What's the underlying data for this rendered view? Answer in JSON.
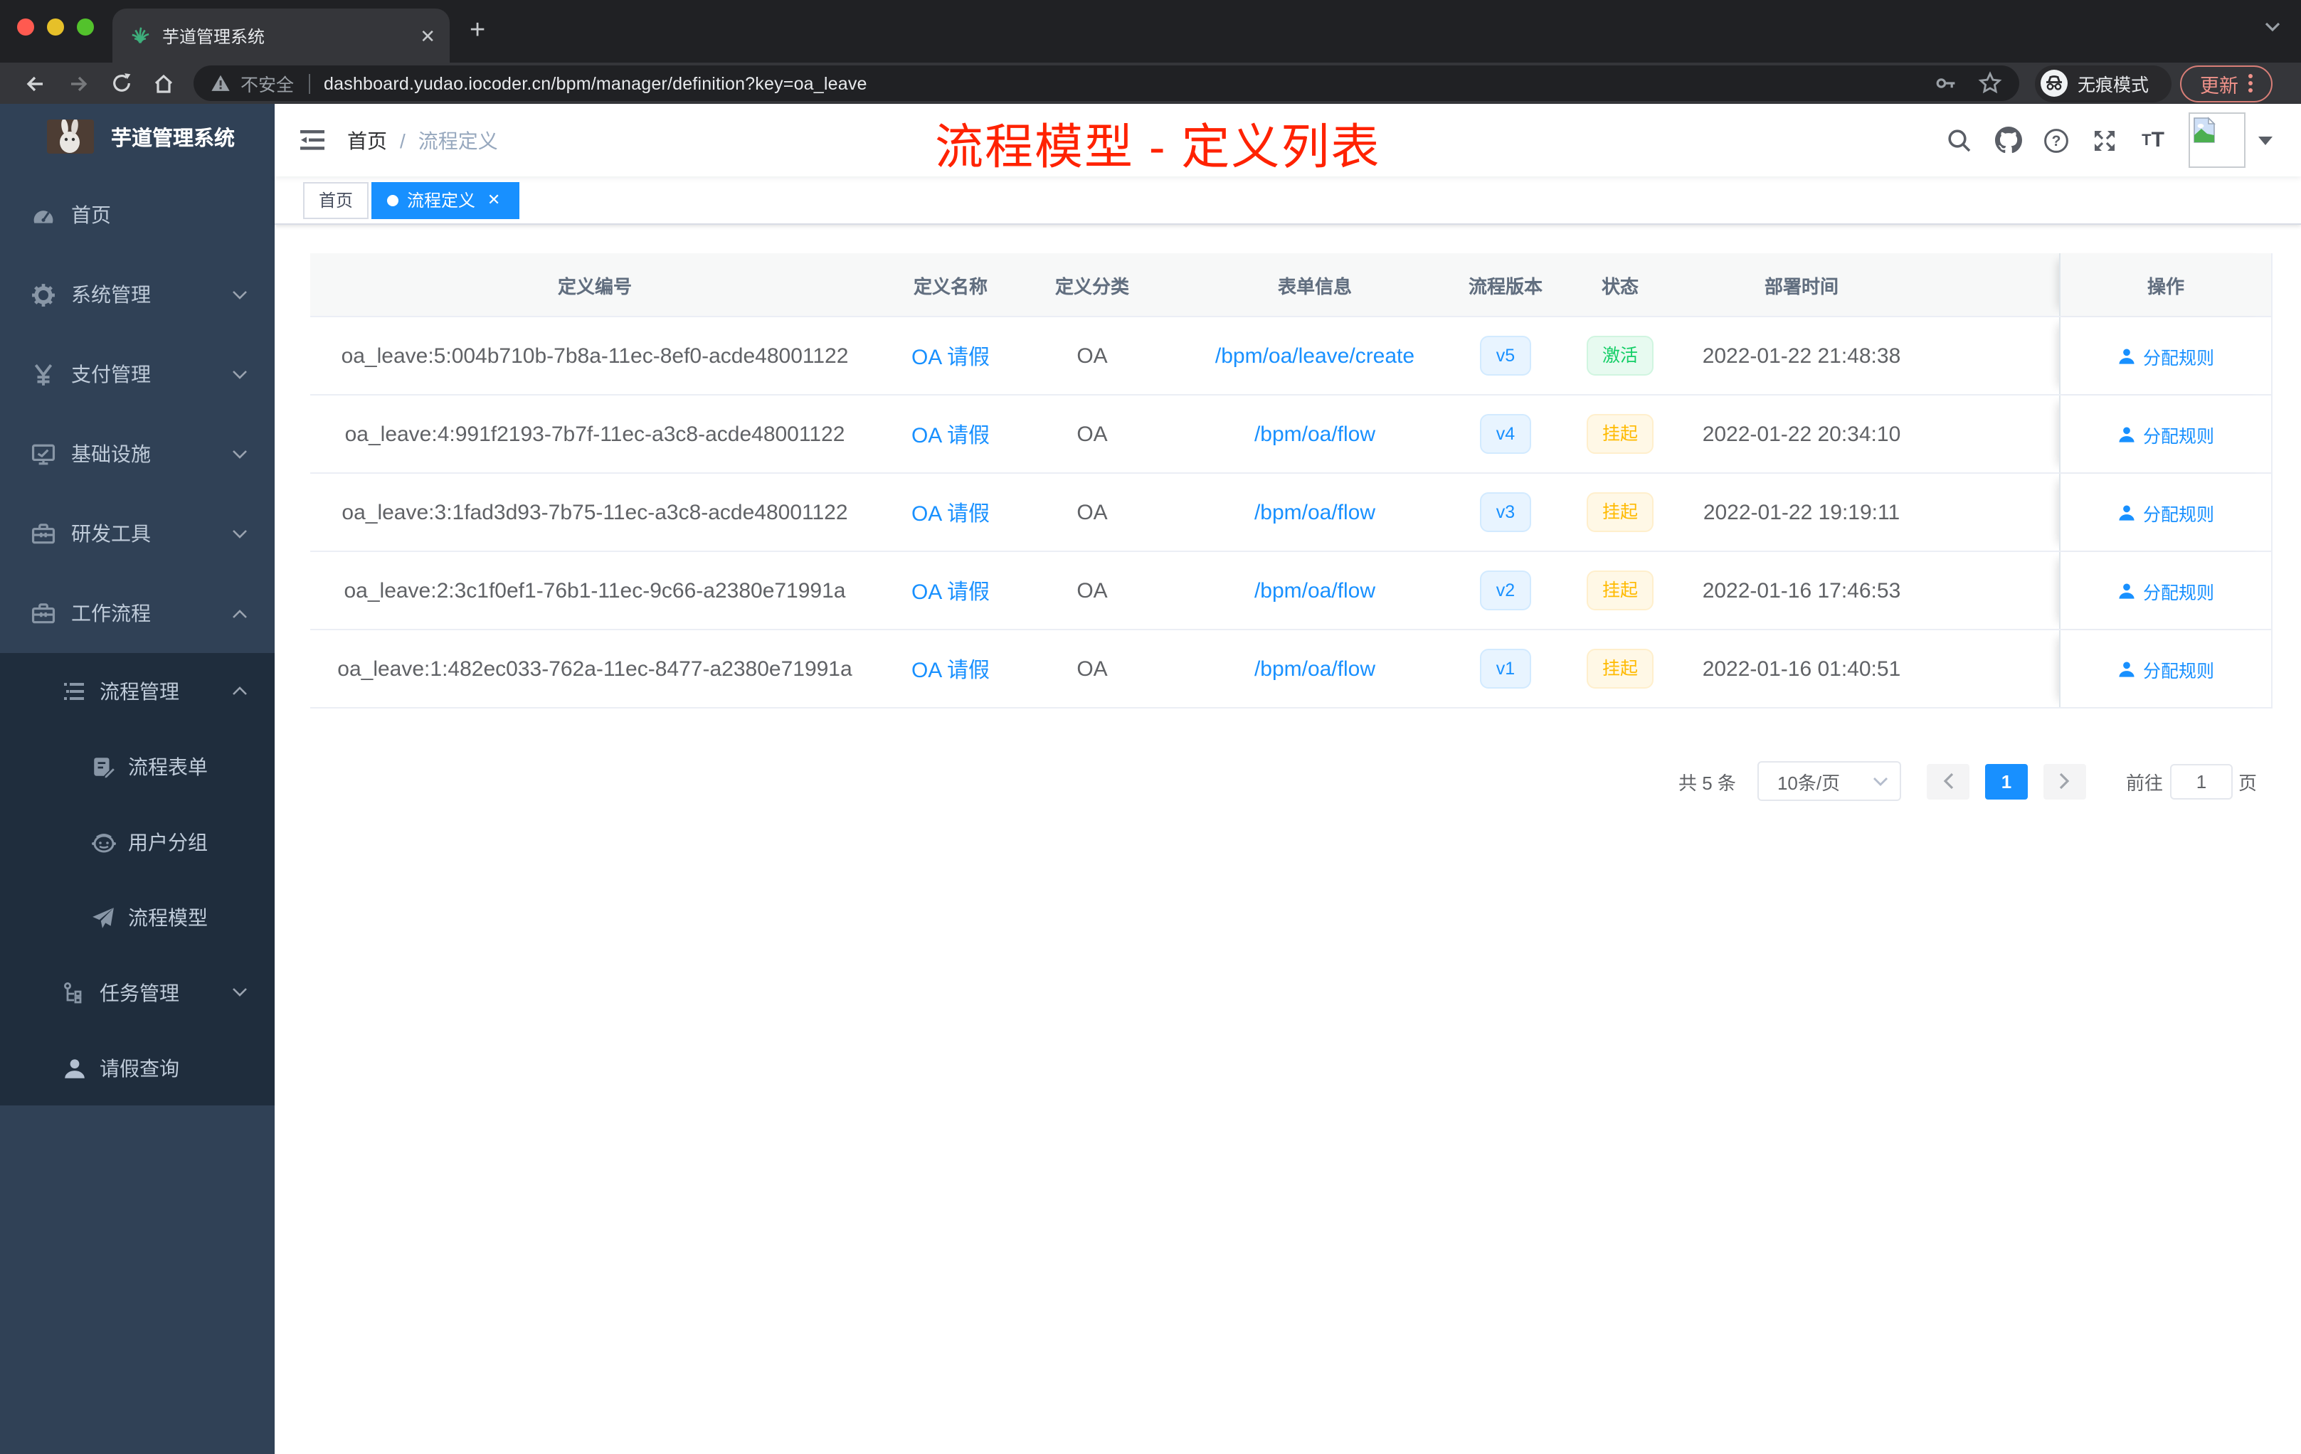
{
  "browser": {
    "tab_title": "芋道管理系统",
    "security_label": "不安全",
    "url": "dashboard.yudao.iocoder.cn/bpm/manager/definition?key=oa_leave",
    "incognito_label": "无痕模式",
    "update_label": "更新",
    "colors": {
      "tabstrip": "#202124",
      "toolbar": "#35363a",
      "omnibox": "#202124",
      "traffic_red": "#ff5a50",
      "traffic_yellow": "#e6c029",
      "traffic_green": "#53c22c"
    }
  },
  "sidebar": {
    "logo_title": "芋道管理系统",
    "items": [
      {
        "label": "首页",
        "icon": "dashboard-icon",
        "level": 1,
        "chevron": null
      },
      {
        "label": "系统管理",
        "icon": "gear-icon",
        "level": 1,
        "chevron": "down"
      },
      {
        "label": "支付管理",
        "icon": "yen-icon",
        "level": 1,
        "chevron": "down"
      },
      {
        "label": "基础设施",
        "icon": "monitor-icon",
        "level": 1,
        "chevron": "down"
      },
      {
        "label": "研发工具",
        "icon": "toolbox-icon",
        "level": 1,
        "chevron": "down"
      },
      {
        "label": "工作流程",
        "icon": "briefcase-icon",
        "level": 1,
        "chevron": "up"
      },
      {
        "label": "流程管理",
        "icon": "list-tree-icon",
        "level": 2,
        "chevron": "up",
        "sub": true
      },
      {
        "label": "流程表单",
        "icon": "doc-edit-icon",
        "level": 3,
        "chevron": null,
        "sub": true
      },
      {
        "label": "用户分组",
        "icon": "robot-icon",
        "level": 3,
        "chevron": null,
        "sub": true
      },
      {
        "label": "流程模型",
        "icon": "plane-icon",
        "level": 3,
        "chevron": null,
        "sub": true
      },
      {
        "label": "任务管理",
        "icon": "org-icon",
        "level": 2,
        "chevron": "down",
        "sub": true
      },
      {
        "label": "请假查询",
        "icon": "person-icon",
        "level": 2,
        "chevron": null,
        "sub": true
      }
    ]
  },
  "navbar": {
    "breadcrumb": {
      "first": "首页",
      "separator": "/",
      "last": "流程定义"
    },
    "annotation": "流程模型 - 定义列表",
    "annotation_color": "#fe1414"
  },
  "tags": [
    {
      "label": "首页",
      "active": false
    },
    {
      "label": "流程定义",
      "active": true
    }
  ],
  "table": {
    "columns": [
      "定义编号",
      "定义名称",
      "定义分类",
      "表单信息",
      "流程版本",
      "状态",
      "部署时间",
      "操作"
    ],
    "action_label": "分配规则",
    "rows": [
      {
        "id": "oa_leave:5:004b710b-7b8a-11ec-8ef0-acde48001122",
        "name": "OA 请假",
        "category": "OA",
        "form": "/bpm/oa/leave/create",
        "version": "v5",
        "status": "激活",
        "status_type": "green",
        "deploy_time": "2022-01-22 21:48:38"
      },
      {
        "id": "oa_leave:4:991f2193-7b7f-11ec-a3c8-acde48001122",
        "name": "OA 请假",
        "category": "OA",
        "form": "/bpm/oa/flow",
        "version": "v4",
        "status": "挂起",
        "status_type": "yellow",
        "deploy_time": "2022-01-22 20:34:10"
      },
      {
        "id": "oa_leave:3:1fad3d93-7b75-11ec-a3c8-acde48001122",
        "name": "OA 请假",
        "category": "OA",
        "form": "/bpm/oa/flow",
        "version": "v3",
        "status": "挂起",
        "status_type": "yellow",
        "deploy_time": "2022-01-22 19:19:11"
      },
      {
        "id": "oa_leave:2:3c1f0ef1-76b1-11ec-9c66-a2380e71991a",
        "name": "OA 请假",
        "category": "OA",
        "form": "/bpm/oa/flow",
        "version": "v2",
        "status": "挂起",
        "status_type": "yellow",
        "deploy_time": "2022-01-16 17:46:53"
      },
      {
        "id": "oa_leave:1:482ec033-762a-11ec-8477-a2380e71991a",
        "name": "OA 请假",
        "category": "OA",
        "form": "/bpm/oa/flow",
        "version": "v1",
        "status": "挂起",
        "status_type": "yellow",
        "deploy_time": "2022-01-16 01:40:51"
      }
    ]
  },
  "pagination": {
    "total_label": "共 5 条",
    "page_size": "10条/页",
    "current_page": "1",
    "goto_label": "前往",
    "goto_value": "1",
    "page_unit": "页"
  },
  "theme": {
    "primary": "#1890ff",
    "success": "#13ce66",
    "warning": "#ffba00"
  }
}
